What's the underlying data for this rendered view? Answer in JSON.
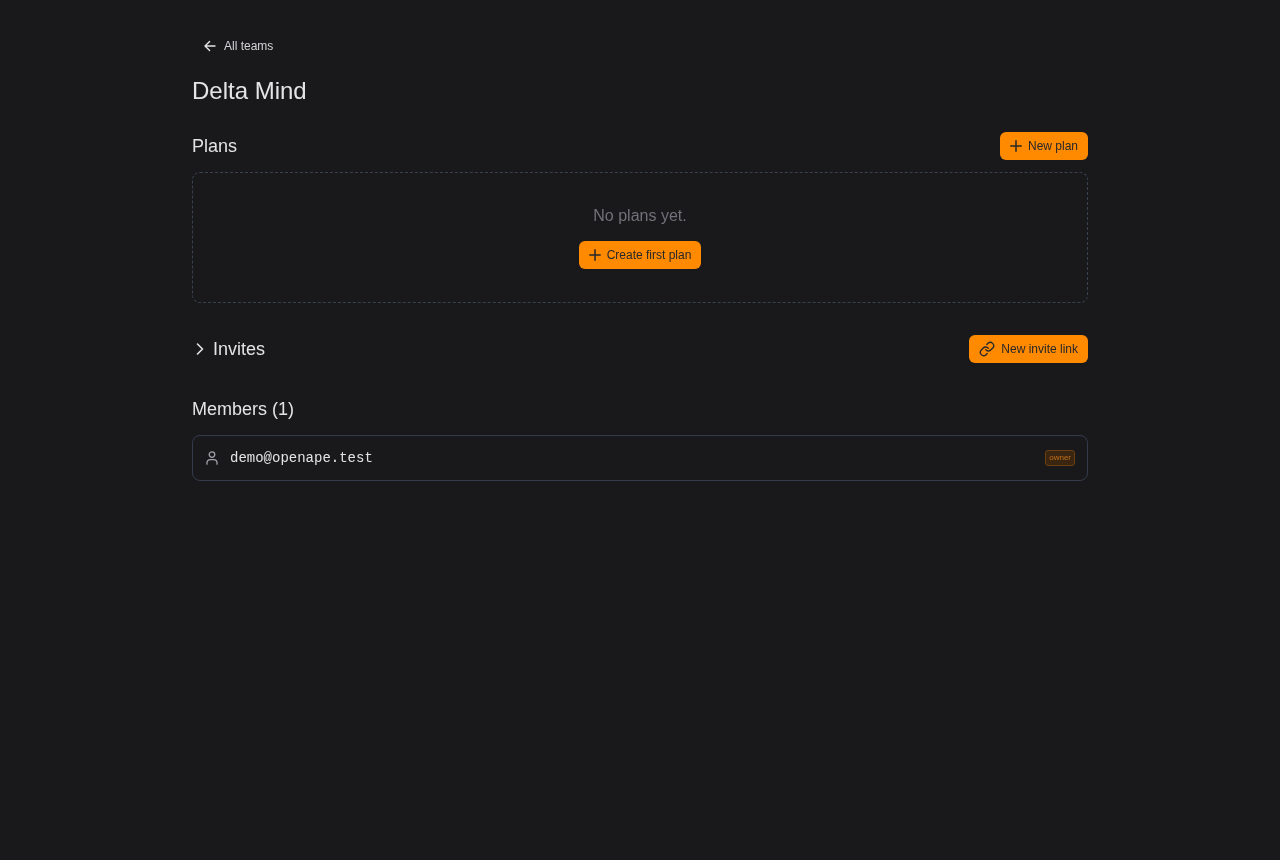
{
  "back_link": {
    "label": "All teams"
  },
  "team": {
    "name": "Delta Mind"
  },
  "plans": {
    "title": "Plans",
    "new_button": "New plan",
    "empty_text": "No plans yet.",
    "create_button": "Create first plan"
  },
  "invites": {
    "title": "Invites",
    "expanded": false,
    "new_button": "New invite link"
  },
  "members": {
    "title": "Members (1)",
    "items": [
      {
        "email": "demo@openape.test",
        "role": "owner"
      }
    ]
  }
}
